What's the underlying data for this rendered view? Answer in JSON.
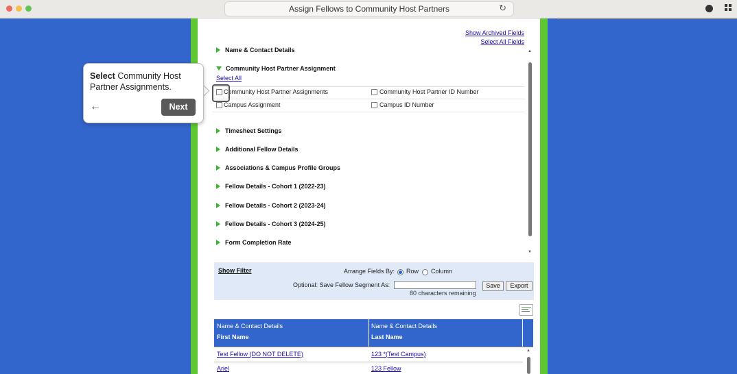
{
  "window": {
    "title": "Assign Fellows to Community Host Partners",
    "dot_colors": [
      "#ec6a5e",
      "#f4bf4f",
      "#61c554"
    ]
  },
  "links": {
    "show_archived": "Show Archived Fields",
    "select_all_fields": "Select All Fields"
  },
  "sections": {
    "name_contact": "Name & Contact Details",
    "chp_assignment": "Community Host Partner Assignment",
    "select_all": "Select All",
    "checkboxes": {
      "chp_assignments": "Community Host Partner Assignments",
      "chp_id": "Community Host Partner ID Number",
      "campus_assignment": "Campus Assignment",
      "campus_id": "Campus ID Number"
    },
    "collapsed": [
      "Timesheet Settings",
      "Additional Fellow Details",
      "Associations & Campus Profile Groups",
      "Fellow Details - Cohort 1 (2022-23)",
      "Fellow Details - Cohort 2 (2023-24)",
      "Fellow Details - Cohort 3 (2024-25)",
      "Form Completion Rate"
    ]
  },
  "filter": {
    "show_filter": "Show Filter",
    "arrange_label": "Arrange Fields By:",
    "row": "Row",
    "column": "Column",
    "selected": "Row",
    "save_segment_label": "Optional: Save Fellow Segment As:",
    "segment_value": "",
    "chars_remaining": "80 characters remaining",
    "save": "Save",
    "export": "Export"
  },
  "table": {
    "group_headers": [
      "Name & Contact Details",
      "Name & Contact Details"
    ],
    "columns": [
      "First Name",
      "Last Name"
    ],
    "rows": [
      [
        "Test Fellow (DO NOT DELETE)",
        "123 *(Test Campus)"
      ],
      [
        "Ariel",
        "123 Fellow"
      ]
    ]
  },
  "tooltip": {
    "bold": "Select",
    "text": "Community Host Partner Assignments.",
    "next": "Next"
  }
}
